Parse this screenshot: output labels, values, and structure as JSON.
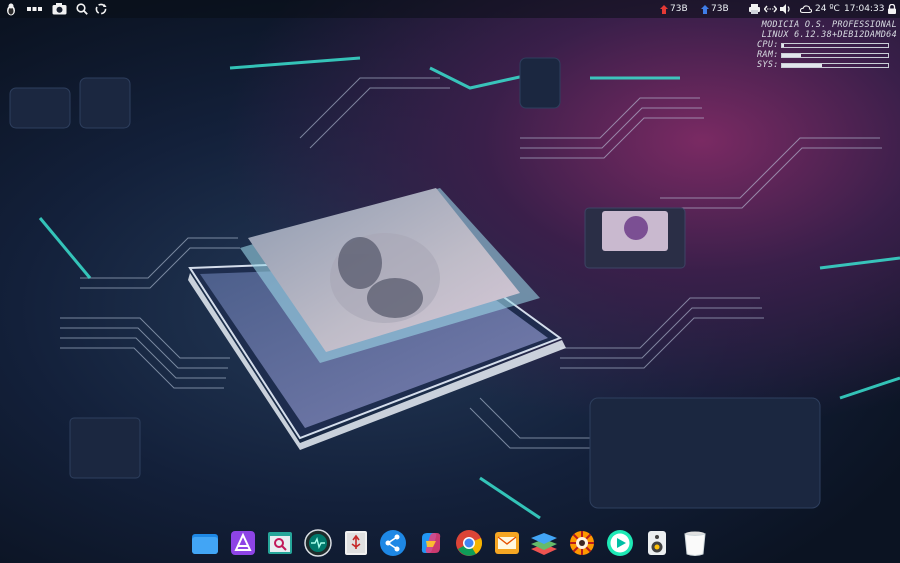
{
  "panel": {
    "left_icons": [
      "tux-menu-icon",
      "apps-dots-icon",
      "screenshot-icon",
      "search-icon",
      "recycle-icon"
    ],
    "updates_red": "73B",
    "updates_blue": "73B",
    "weather": "24 ºC",
    "clock": "17:04:33",
    "tray_icons": [
      "printer-icon",
      "network-icon",
      "volume-icon",
      "weather-icon",
      "lock-icon"
    ]
  },
  "conky": {
    "line1": "MODICIA O.S. PROFESSIONAL",
    "line2": "LINUX  6.12.38+DEB12DAMD64",
    "cpu_label": "CPU:",
    "ram_label": "RAM:",
    "sys_label": "SYS:",
    "cpu_usage": 0.02,
    "ram_usage": 0.18,
    "sys_usage": 0.38
  },
  "dock": {
    "items": [
      "files-icon",
      "app-store-icon",
      "document-viewer-icon",
      "system-monitor-icon",
      "usb-creator-icon",
      "share-icon",
      "copilot-icon",
      "chrome-icon",
      "mail-icon",
      "layers-icon",
      "xnview-icon",
      "media-player-icon",
      "speaker-icon",
      "trash-icon"
    ]
  },
  "colors": {
    "accent_teal": "#39e0cf",
    "magenta_glow": "#7a2a63",
    "board_dark": "#0b1322"
  }
}
